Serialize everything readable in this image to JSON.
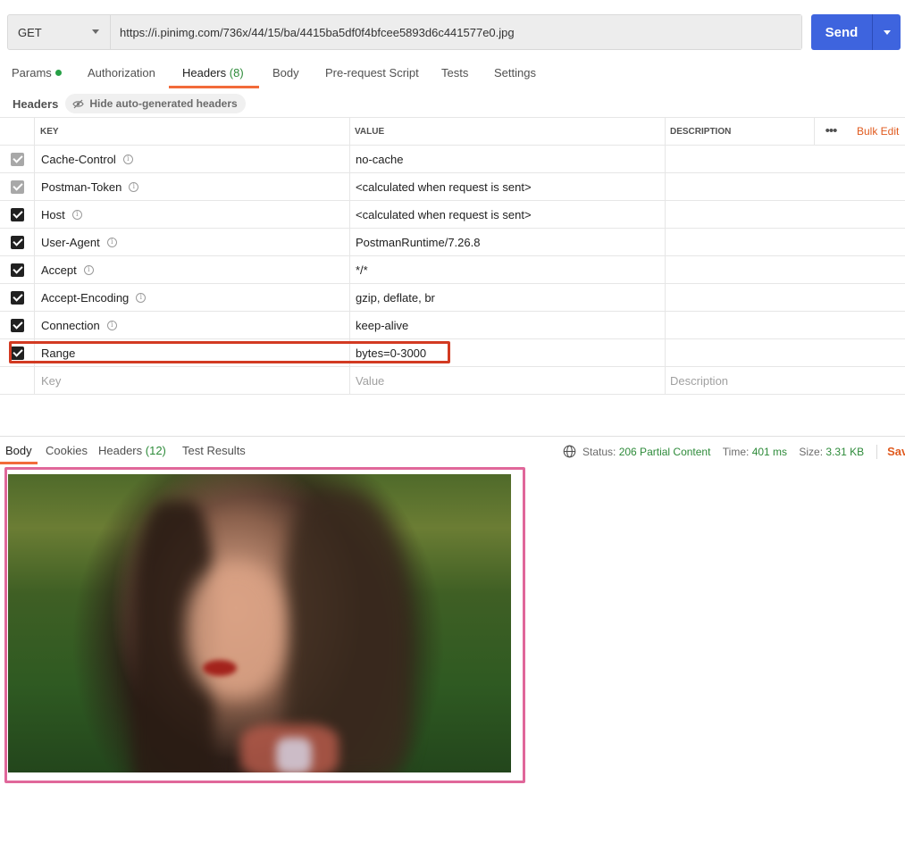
{
  "request": {
    "method": "GET",
    "url": "https://i.pinimg.com/736x/44/15/ba/4415ba5df0f4bfcee5893d6c441577e0.jpg",
    "send_label": "Send"
  },
  "tabs": [
    {
      "label": "Params",
      "dot": true
    },
    {
      "label": "Authorization"
    },
    {
      "label": "Headers",
      "count": "(8)",
      "active": true
    },
    {
      "label": "Body"
    },
    {
      "label": "Pre-request Script"
    },
    {
      "label": "Tests"
    },
    {
      "label": "Settings"
    }
  ],
  "headers_bar": {
    "title": "Headers",
    "toggle_label": "Hide auto-generated headers"
  },
  "table": {
    "columns": {
      "key": "KEY",
      "value": "VALUE",
      "description": "DESCRIPTION"
    },
    "more_label": "•••",
    "bulk_edit": "Bulk Edit",
    "rows": [
      {
        "key": "Cache-Control",
        "value": "no-cache",
        "checked": "grey"
      },
      {
        "key": "Postman-Token",
        "value": "<calculated when request is sent>",
        "checked": "grey"
      },
      {
        "key": "Host",
        "value": "<calculated when request is sent>",
        "checked": "black"
      },
      {
        "key": "User-Agent",
        "value": "PostmanRuntime/7.26.8",
        "checked": "black"
      },
      {
        "key": "Accept",
        "value": "*/*",
        "checked": "black"
      },
      {
        "key": "Accept-Encoding",
        "value": "gzip, deflate, br",
        "checked": "black"
      },
      {
        "key": "Connection",
        "value": "keep-alive",
        "checked": "black"
      },
      {
        "key": "Range",
        "value": "bytes=0-3000",
        "checked": "black"
      }
    ],
    "placeholders": {
      "key": "Key",
      "value": "Value",
      "description": "Description"
    }
  },
  "response": {
    "tabs": [
      {
        "label": "Body",
        "active": true
      },
      {
        "label": "Cookies"
      },
      {
        "label": "Headers",
        "count": "(12)"
      },
      {
        "label": "Test Results"
      }
    ],
    "status_label": "Status:",
    "status_value": "206 Partial Content",
    "time_label": "Time:",
    "time_value": "401 ms",
    "size_label": "Size:",
    "size_value": "3.31 KB",
    "save_label": "Sav"
  },
  "colors": {
    "accent": "#f26b3a",
    "send": "#3e64de",
    "success": "#2e8b3a",
    "highlight_red": "#d23a22",
    "highlight_pink": "#e0679a"
  }
}
